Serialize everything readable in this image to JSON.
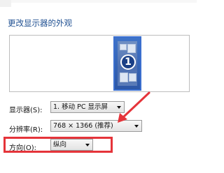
{
  "title": "更改显示器的外观",
  "preview": {
    "monitor_number": "1"
  },
  "display": {
    "label": "显示器(S):",
    "value": "1. 移动 PC 显示屏"
  },
  "resolution": {
    "label": "分辨率(R):",
    "value": "768 × 1366 (推荐)"
  },
  "orientation": {
    "label": "方向(O):",
    "value": "纵向"
  },
  "colors": {
    "title": "#1e4f91",
    "highlight": "#e5343a",
    "monitor": "#3b6fcf"
  }
}
